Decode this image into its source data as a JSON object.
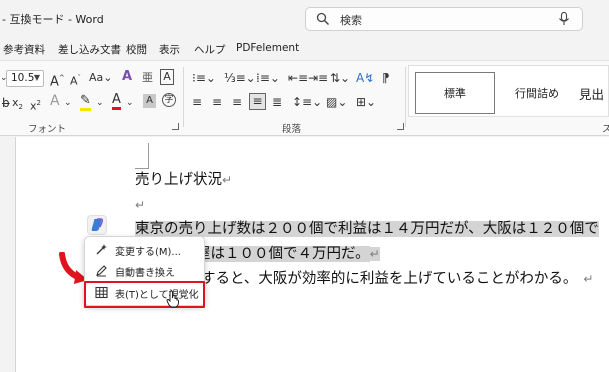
{
  "window": {
    "title": "- 互換モード - Word",
    "search_placeholder": "検索"
  },
  "menu": [
    "参考資料",
    "差し込み文書",
    "校閲",
    "表示",
    "ヘルプ",
    "PDFelement"
  ],
  "ribbon": {
    "font_size": "10.5",
    "font_group_label": "フォント",
    "paragraph_group_label": "段落",
    "styles_group_label": "ス",
    "styles": [
      "標準",
      "行間詰め",
      "見出"
    ]
  },
  "document": {
    "heading": "売り上げ状況",
    "line1": "東京の売り上げ数は２００個で利益は１４万円だが、大阪は１２０個で",
    "line2": "名古屋は１００個で４万円だ。",
    "line3": "すると、大阪が効率的に利益を上げていることがわかる。"
  },
  "context_menu": {
    "items": [
      {
        "label": "変更する(M)...",
        "icon": "sparkle-pen-icon"
      },
      {
        "label": "自動書き換え",
        "icon": "rewrite-pen-icon"
      },
      {
        "label": "表(T)として視覚化",
        "icon": "table-icon"
      }
    ],
    "highlight_color": "#e0141e"
  }
}
